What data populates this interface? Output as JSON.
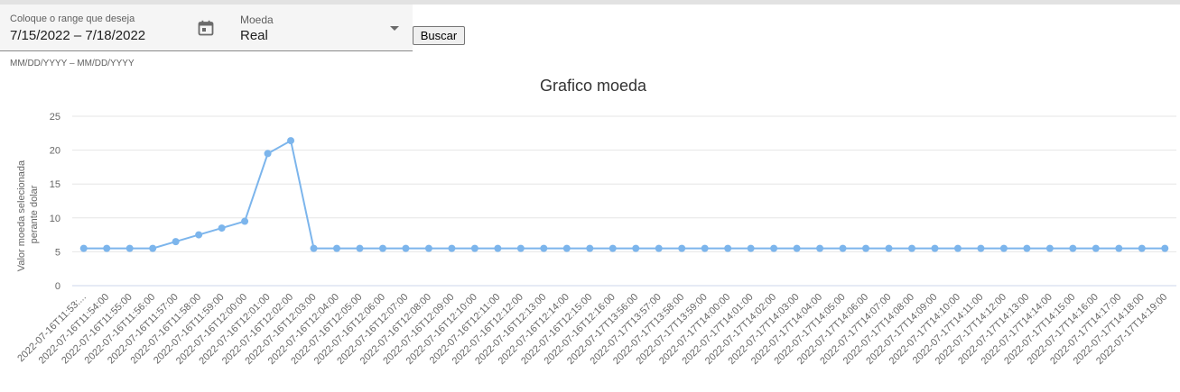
{
  "form": {
    "date_range": {
      "label": "Coloque o range que deseja",
      "value": "7/15/2022 – 7/18/2022",
      "hint": "MM/DD/YYYY – MM/DD/YYYY",
      "icon": "calendar-icon"
    },
    "currency": {
      "label": "Moeda",
      "value": "Real",
      "icon": "dropdown-arrow-icon"
    },
    "search_button": "Buscar"
  },
  "chart_data": {
    "type": "line",
    "title": "Grafico moeda",
    "ylabel": "Valor moeda selecionada perante dolar",
    "ylabel_lines": [
      "Valor moeda selecionada",
      "perante dolar"
    ],
    "xlabel": "",
    "ylim": [
      0,
      25
    ],
    "yticks": [
      0,
      5,
      10,
      15,
      20,
      25
    ],
    "grid": true,
    "color": "#7cb5ec",
    "categories": [
      "2022-07-16T11:53:...",
      "2022-07-16T11:54:00",
      "2022-07-16T11:55:00",
      "2022-07-16T11:56:00",
      "2022-07-16T11:57:00",
      "2022-07-16T11:58:00",
      "2022-07-16T11:59:00",
      "2022-07-16T12:00:00",
      "2022-07-16T12:01:00",
      "2022-07-16T12:02:00",
      "2022-07-16T12:03:00",
      "2022-07-16T12:04:00",
      "2022-07-16T12:05:00",
      "2022-07-16T12:06:00",
      "2022-07-16T12:07:00",
      "2022-07-16T12:08:00",
      "2022-07-16T12:09:00",
      "2022-07-16T12:10:00",
      "2022-07-16T12:11:00",
      "2022-07-16T12:12:00",
      "2022-07-16T12:13:00",
      "2022-07-16T12:14:00",
      "2022-07-16T12:15:00",
      "2022-07-16T12:16:00",
      "2022-07-17T13:56:00",
      "2022-07-17T13:57:00",
      "2022-07-17T13:58:00",
      "2022-07-17T13:59:00",
      "2022-07-17T14:00:00",
      "2022-07-17T14:01:00",
      "2022-07-17T14:02:00",
      "2022-07-17T14:03:00",
      "2022-07-17T14:04:00",
      "2022-07-17T14:05:00",
      "2022-07-17T14:06:00",
      "2022-07-17T14:07:00",
      "2022-07-17T14:08:00",
      "2022-07-17T14:09:00",
      "2022-07-17T14:10:00",
      "2022-07-17T14:11:00",
      "2022-07-17T14:12:00",
      "2022-07-17T14:13:00",
      "2022-07-17T14:14:00",
      "2022-07-17T14:15:00",
      "2022-07-17T14:16:00",
      "2022-07-17T14:17:00",
      "2022-07-17T14:18:00",
      "2022-07-17T14:19:00"
    ],
    "values": [
      5.5,
      5.5,
      5.5,
      5.5,
      6.5,
      7.5,
      8.5,
      9.5,
      19.5,
      21.4,
      5.5,
      5.5,
      5.5,
      5.5,
      5.5,
      5.5,
      5.5,
      5.5,
      5.5,
      5.5,
      5.5,
      5.5,
      5.5,
      5.5,
      5.5,
      5.5,
      5.5,
      5.5,
      5.5,
      5.5,
      5.5,
      5.5,
      5.5,
      5.5,
      5.5,
      5.5,
      5.5,
      5.5,
      5.5,
      5.5,
      5.5,
      5.5,
      5.5,
      5.5,
      5.5,
      5.5,
      5.5,
      5.5
    ]
  }
}
